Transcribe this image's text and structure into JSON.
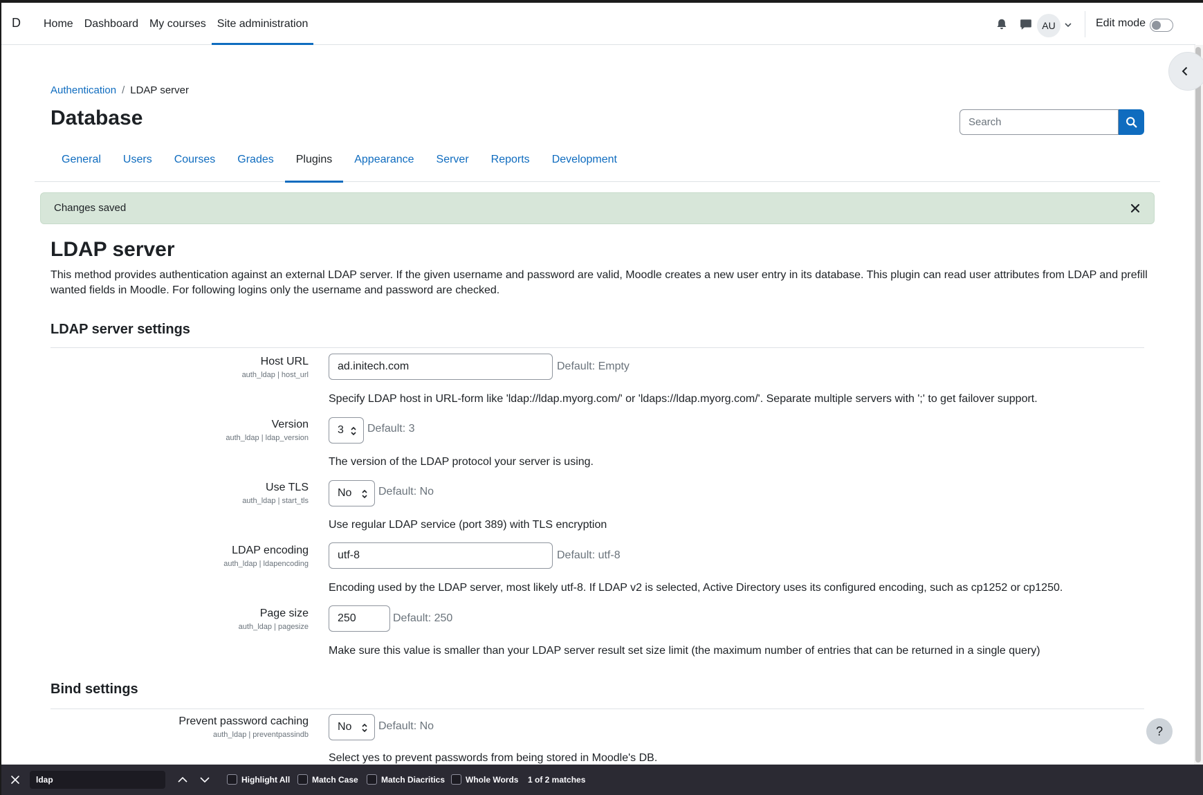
{
  "navbar": {
    "brand": "D",
    "items": [
      "Home",
      "Dashboard",
      "My courses",
      "Site administration"
    ],
    "active_item": "Site administration",
    "avatar_initials": "AU",
    "edit_mode_label": "Edit mode",
    "edit_mode_on": false,
    "icons": [
      "bell-icon",
      "chat-icon",
      "chevron-down-icon"
    ]
  },
  "breadcrumb": {
    "parent": "Authentication",
    "separator": "/",
    "current": "LDAP server"
  },
  "page_title": "Database",
  "search": {
    "placeholder": "Search",
    "value": ""
  },
  "tabs": [
    "General",
    "Users",
    "Courses",
    "Grades",
    "Plugins",
    "Appearance",
    "Server",
    "Reports",
    "Development"
  ],
  "active_tab": "Plugins",
  "alert": {
    "message": "Changes saved"
  },
  "content": {
    "heading": "LDAP server",
    "intro": "This method provides authentication against an external LDAP server. If the given username and password are valid, Moodle creates a new user entry in its database. This plugin can read user attributes from LDAP and prefill wanted fields in Moodle. For following logins only the username and password are checked.",
    "server_section": "LDAP server settings",
    "bind_section": "Bind settings"
  },
  "settings": {
    "host_url": {
      "label": "Host URL",
      "key": "auth_ldap | host_url",
      "value": "ad.initech.com",
      "default": "Default: Empty",
      "description": "Specify LDAP host in URL-form like 'ldap://ldap.myorg.com/' or 'ldaps://ldap.myorg.com/'. Separate multiple servers with ';' to get failover support."
    },
    "version": {
      "label": "Version",
      "key": "auth_ldap | ldap_version",
      "value": "3",
      "default": "Default: 3",
      "description": "The version of the LDAP protocol your server is using."
    },
    "use_tls": {
      "label": "Use TLS",
      "key": "auth_ldap | start_tls",
      "value": "No",
      "default": "Default: No",
      "description": "Use regular LDAP service (port 389) with TLS encryption"
    },
    "ldap_encoding": {
      "label": "LDAP encoding",
      "key": "auth_ldap | ldapencoding",
      "value": "utf-8",
      "default": "Default: utf-8",
      "description": "Encoding used by the LDAP server, most likely utf-8. If LDAP v2 is selected, Active Directory uses its configured encoding, such as cp1252 or cp1250."
    },
    "page_size": {
      "label": "Page size",
      "key": "auth_ldap | pagesize",
      "value": "250",
      "default": "Default: 250",
      "description": "Make sure this value is smaller than your LDAP server result set size limit (the maximum number of entries that can be returned in a single query)"
    },
    "prevent_password_caching": {
      "label": "Prevent password caching",
      "key": "auth_ldap | preventpassindb",
      "value": "No",
      "default": "Default: No",
      "description": "Select yes to prevent passwords from being stored in Moodle's DB."
    }
  },
  "help_button": "?",
  "findbar": {
    "query": "ldap",
    "options": [
      "Highlight All",
      "Match Case",
      "Match Diacritics",
      "Whole Words"
    ],
    "status": "1 of 2 matches"
  },
  "colors": {
    "primary": "#0f6cbf",
    "success_bg": "#d7e6d9",
    "findbar_bg": "#2b2a33"
  }
}
